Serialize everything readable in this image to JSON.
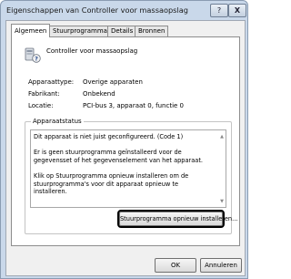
{
  "window": {
    "title": "Eigenschappen van Controller voor massaopslag",
    "help_glyph": "?",
    "close_glyph": "X"
  },
  "tabs": [
    {
      "label": "Algemeen"
    },
    {
      "label": "Stuurprogramma"
    },
    {
      "label": "Details"
    },
    {
      "label": "Bronnen"
    }
  ],
  "device": {
    "name": "Controller voor massaopslag",
    "icon": "storage-controller-icon"
  },
  "properties": [
    {
      "label": "Apparaattype:",
      "value": "Overige apparaten"
    },
    {
      "label": "Fabrikant:",
      "value": "Onbekend"
    },
    {
      "label": "Locatie:",
      "value": "PCI-bus 3, apparaat 0, functie 0"
    }
  ],
  "status": {
    "group_title": "Apparaatstatus",
    "text": "Dit apparaat is niet juist geconfigureerd. (Code 1)\n\nEr is geen stuurprogramma geïnstalleerd voor de gegevensset of het gegevenselement van het apparaat.\n\nKlik op Stuurprogramma opnieuw installeren om de stuurprogramma's voor dit apparaat opnieuw te installeren.",
    "reinstall_label": "Stuurprogramma opnieuw installeren..."
  },
  "buttons": {
    "ok": "OK",
    "cancel": "Annuleren"
  }
}
